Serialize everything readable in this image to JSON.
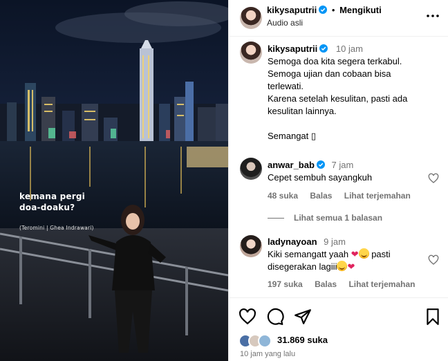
{
  "post": {
    "username": "kikysaputrii",
    "follow_label": "Mengikuti",
    "separator": "•",
    "audio_label": "Audio asli",
    "overlay_caption_line1": "kemana pergi",
    "overlay_caption_line2": "doa-doaku?",
    "overlay_credit": "(Teromini | Ghea Indrawari)"
  },
  "caption": {
    "username": "kikysaputrii",
    "time": "10 jam",
    "lines": [
      "Semoga doa kita segera terkabul.",
      "Semoga ujian dan cobaan bisa",
      "terlewati.",
      "Karena setelah kesulitan, pasti ada",
      "kesulitan lainnya.",
      "",
      "Semangat ▯"
    ]
  },
  "comments": [
    {
      "username": "anwar_bab",
      "time": "7 jam",
      "text": "Cepet sembuh sayangkuh",
      "likes": "48 suka",
      "reply_label": "Balas",
      "translate_label": "Lihat terjemahan",
      "view_replies": "Lihat semua 1 balasan"
    },
    {
      "username": "ladynayoan",
      "time": "9 jam",
      "text_part1": "Kiki semangatt yaah ",
      "text_part2": " pasti",
      "text_line2": "disegerakan lagiii",
      "likes": "197 suka",
      "reply_label": "Balas",
      "translate_label": "Lihat terjemahan"
    }
  ],
  "footer": {
    "likes_count": "31.869 suka",
    "time_ago": "10 jam yang lalu"
  },
  "colors": {
    "verified": "#0095f6",
    "heart_emoji": "#e0245e",
    "muted_text": "#737373"
  },
  "icons": [
    "verified-badge-icon",
    "more-options-icon",
    "heart-icon",
    "comment-icon",
    "share-icon",
    "save-icon"
  ]
}
